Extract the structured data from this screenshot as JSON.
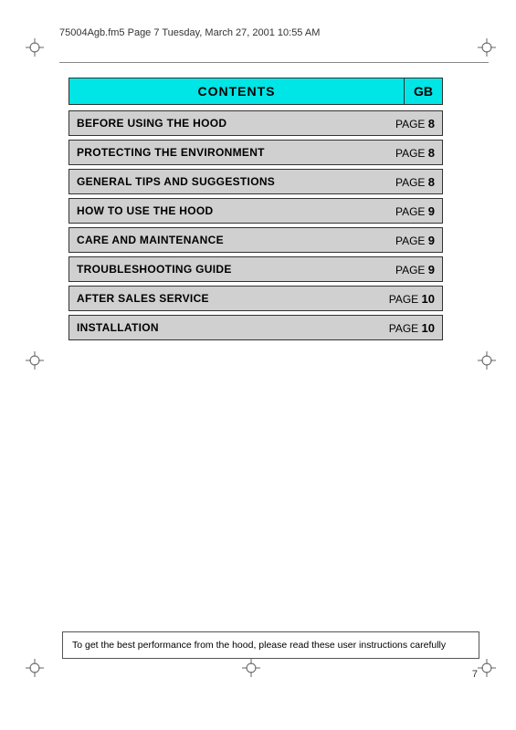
{
  "header": {
    "filename": "75004Agb.fm5  Page 7  Tuesday, March 27, 2001  10:55 AM"
  },
  "contents": {
    "title": "CONTENTS",
    "gb_label": "GB"
  },
  "toc": {
    "items": [
      {
        "title": "BEFORE USING THE HOOD",
        "page_label": "PAGE",
        "page_number": "8"
      },
      {
        "title": "PROTECTING THE ENVIRONMENT",
        "page_label": "PAGE",
        "page_number": "8"
      },
      {
        "title": "GENERAL TIPS AND SUGGESTIONS",
        "page_label": "PAGE",
        "page_number": "8"
      },
      {
        "title": "HOW TO USE THE HOOD",
        "page_label": "PAGE",
        "page_number": "9"
      },
      {
        "title": "CARE AND MAINTENANCE",
        "page_label": "PAGE",
        "page_number": "9"
      },
      {
        "title": "TROUBLESHOOTING GUIDE",
        "page_label": "PAGE",
        "page_number": "9"
      },
      {
        "title": "AFTER SALES SERVICE",
        "page_label": "PAGE",
        "page_number": "10"
      },
      {
        "title": "INSTALLATION",
        "page_label": "PAGE",
        "page_number": "10"
      }
    ]
  },
  "footer": {
    "note": "To get the best performance from the hood, please read these user instructions carefully"
  },
  "page_number": "7"
}
